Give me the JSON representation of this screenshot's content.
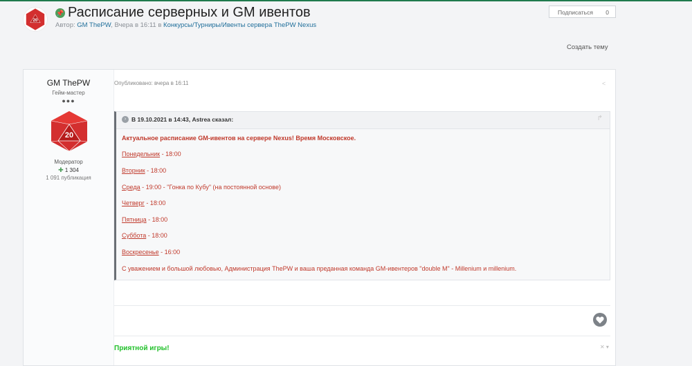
{
  "header": {
    "title": "Расписание серверных и GM ивентов",
    "meta_prefix": "Автор:",
    "meta_author": "GM ThePW",
    "meta_sep": ",",
    "meta_time": "Вчера в 16:11",
    "meta_in": "в",
    "meta_forum": "Конкурсы/Турниры/Ивенты сервера ThePW Nexus",
    "follow_label": "Подписаться",
    "follow_count": "0",
    "create_topic": "Создать тему"
  },
  "author": {
    "name": "GM ThePW",
    "role": "Гейм-мастер",
    "rank_dots": "●●●",
    "avatar_number": "20",
    "group": "Модератор",
    "reputation": "1 304",
    "posts": "1 091 публикация"
  },
  "post": {
    "published": "Опубликовано: вчера в 16:11",
    "quote_citation": "В 19.10.2021 в 14:43, Astrea сказал:",
    "intro": "Актуальное расписание GM-ивентов на сервере Nexus! Время Московское.",
    "schedule": [
      {
        "day": "Понедельник",
        "rest": " - 18:00"
      },
      {
        "day": "Вторник",
        "rest": " - 18:00"
      },
      {
        "day": "Среда",
        "rest": " - 19:00 - \"Гонка по Кубу\" (на постоянной основе)"
      },
      {
        "day": "Четверг",
        "rest": " - 18:00"
      },
      {
        "day": "Пятница",
        "rest": " - 18:00"
      },
      {
        "day": "Суббота",
        "rest": " - 18:00"
      },
      {
        "day": "Воскресенье",
        "rest": " - 16:00"
      }
    ],
    "closing": "С уважением и большой любовью, Администрация ThePW и ваша преданная команда GM-ивентеров \"double M\" - Millenium и millenium.",
    "signature": "Приятной игры!"
  },
  "icons": {
    "pin": "pin-icon",
    "share": "share-icon",
    "quote": "quote-icon",
    "reply": "reply-icon",
    "like": "heart-icon"
  },
  "colors": {
    "accent": "#1f7a4d",
    "quote_text": "#c0392b",
    "signature": "#22c02b",
    "avatar_die": "#d32f2f"
  }
}
